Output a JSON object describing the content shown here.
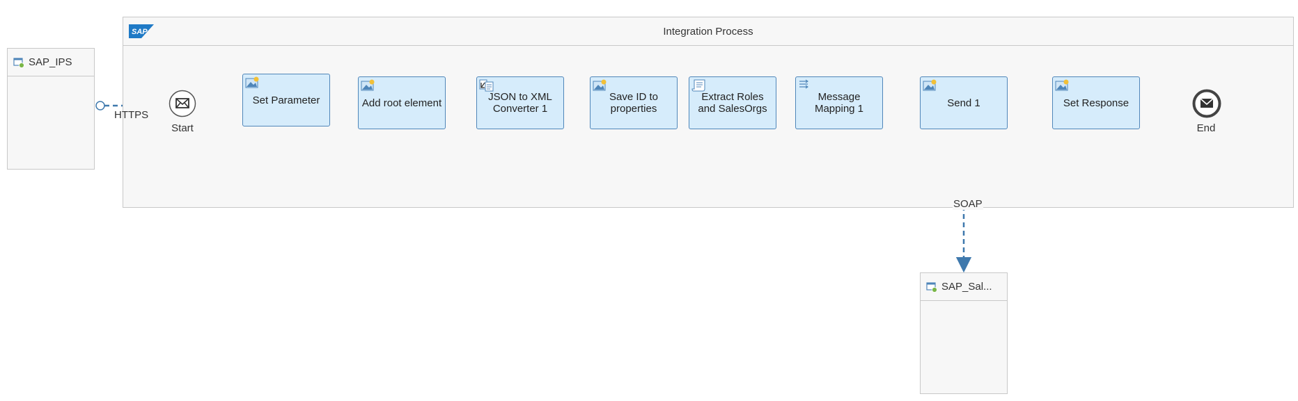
{
  "pool": {
    "title": "Integration Process",
    "logo": "SAP"
  },
  "participants": [
    {
      "name": "SAP_IPS"
    },
    {
      "name": "SAP_Sal..."
    }
  ],
  "events": {
    "start": {
      "label": "Start",
      "icon": "envelope-icon"
    },
    "end": {
      "label": "End",
      "icon": "envelope-filled-icon"
    }
  },
  "steps": [
    {
      "label": "Set Parameter",
      "icon": "content-modifier-icon"
    },
    {
      "label": "Add root element",
      "icon": "content-modifier-icon"
    },
    {
      "label": "JSON to XML Converter 1",
      "icon": "converter-icon"
    },
    {
      "label": "Save ID to properties",
      "icon": "content-modifier-icon"
    },
    {
      "label": "Extract Roles and SalesOrgs",
      "icon": "script-icon"
    },
    {
      "label": "Message Mapping 1",
      "icon": "mapping-icon"
    },
    {
      "label": "Send 1",
      "icon": "content-modifier-icon"
    },
    {
      "label": "Set Response",
      "icon": "content-modifier-icon"
    }
  ],
  "connections": {
    "sender": "HTTPS",
    "receiver": "SOAP"
  },
  "colors": {
    "stepFill": "#d6ecfb",
    "stepBorder": "#4f86b9",
    "flow": "#3f79ad",
    "sapBlue": "#1f7ac6"
  }
}
